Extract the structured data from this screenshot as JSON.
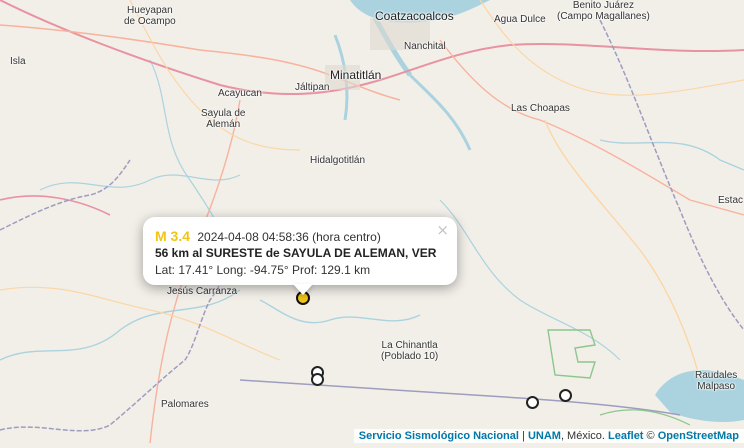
{
  "places": {
    "hueyapan": "Hueyapan\nde Ocampo",
    "coatzacoalcos": "Coatzacoalcos",
    "agua_dulce": "Agua Dulce",
    "benito_juarez": "Benito Juárez\n(Campo Magallanes)",
    "isla": "Isla",
    "nanchital": "Nanchital",
    "minatitlan": "Minatitlán",
    "acayucan": "Acayucan",
    "jaltipan": "Jáltipan",
    "las_choapas": "Las Choapas",
    "sayula": "Sayula de\nAlemán",
    "hidalgotitlan": "Hidalgotitlán",
    "estac": "Estac",
    "jesus_carranza": "Jesús Carranza",
    "la_chinantla": "La Chinantla\n(Poblado 10)",
    "palomares": "Palomares",
    "raudales": "Raudales\nMalpaso"
  },
  "popup": {
    "magnitude": "M 3.4",
    "datetime": "2024-04-08  04:58:36 (hora centro)",
    "location": "56 km al SURESTE de SAYULA DE ALEMAN, VER",
    "coords": "Lat: 17.41°  Long: -94.75°  Prof: 129.1 km",
    "close": "×"
  },
  "attribution": {
    "ssn": "Servicio Sismológico Nacional",
    "sep1": " | ",
    "unam": "UNAM",
    "mexico": ", México.  ",
    "leaflet": "Leaflet",
    "copy": " © ",
    "osm": "OpenStreetMap"
  },
  "colors": {
    "land": "#f2efe9",
    "water": "#aad3df",
    "highway": "#e892a2",
    "trunk": "#f9b29c",
    "primary": "#fcd6a4",
    "border": "#9e9cbf",
    "active_marker": "#f0c419"
  }
}
